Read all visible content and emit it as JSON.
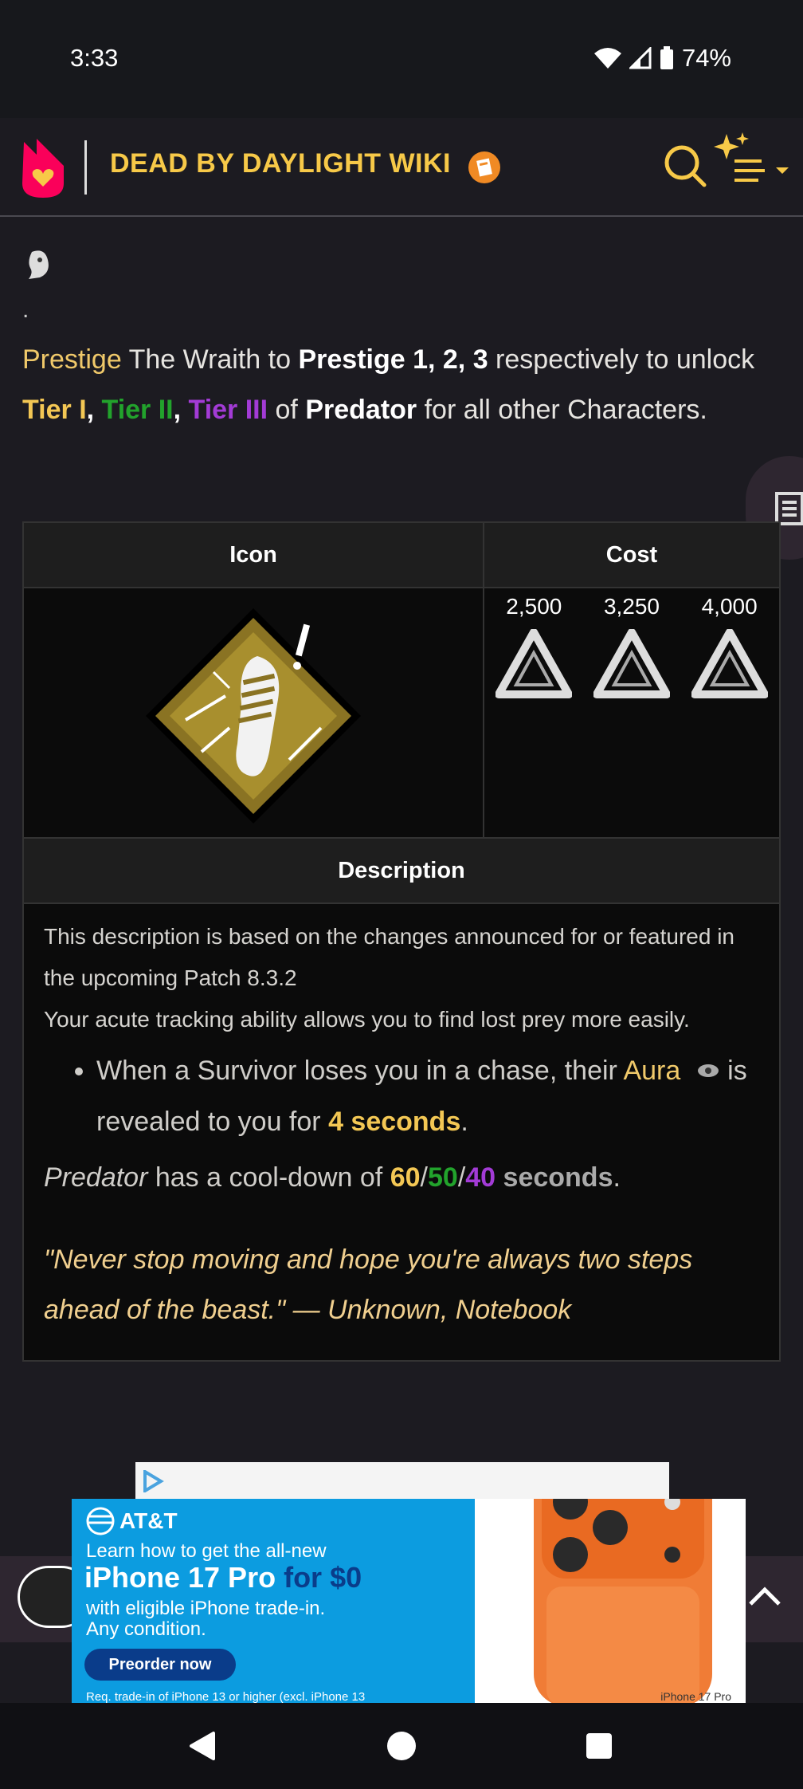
{
  "status": {
    "time": "3:33",
    "battery": "74%"
  },
  "header": {
    "title": "DEAD BY DAYLIGHT WIKI"
  },
  "intro": {
    "bullet": ".",
    "prestige": "Prestige",
    "t1": " The Wraith to ",
    "prestige_levels": "Prestige 1, 2, 3",
    "t2": " respectively to unlock ",
    "tier1": "Tier I",
    "comma1": ", ",
    "tier2": "Tier II",
    "comma2": ", ",
    "tier3": "Tier III",
    "t3": " of ",
    "perk": "Predator",
    "t4": " for all other Characters."
  },
  "table": {
    "icon_header": "Icon",
    "cost_header": "Cost",
    "costs": [
      "2,500",
      "3,250",
      "4,000"
    ],
    "description_header": "Description"
  },
  "description": {
    "note": "This description is based on the changes announced for or featured in the upcoming Patch 8.3.2",
    "summary": "Your acute tracking ability allows you to find lost prey more easily.",
    "bullet_a": "When a Survivor loses you in a chase, their ",
    "bullet_aura": "Aura",
    "bullet_b": " is revealed to you for ",
    "bullet_seconds": "4 seconds",
    "bullet_end": ".",
    "cd_perk": "Predator",
    "cd_text": " has a cool-down of ",
    "cd_1": "60",
    "slash1": "/",
    "cd_2": "50",
    "slash2": "/",
    "cd_3": "40",
    "cd_unit": " seconds",
    "cd_end": ".",
    "quote": "\"Never stop moving and hope you're always two steps ahead of the beast.\" — Unknown, Notebook"
  },
  "ad": {
    "brand": "AT&T",
    "line1": "Learn how to get the all-new",
    "product": "iPhone 17 Pro",
    "offer": " for $0",
    "line2": "with eligible iPhone trade-in.",
    "line3": "Any condition.",
    "cta": "Preorder now",
    "fine": "Req. trade-in of iPhone 13 or higher (excl. iPhone 13",
    "phone_label": "iPhone 17 Pro"
  }
}
